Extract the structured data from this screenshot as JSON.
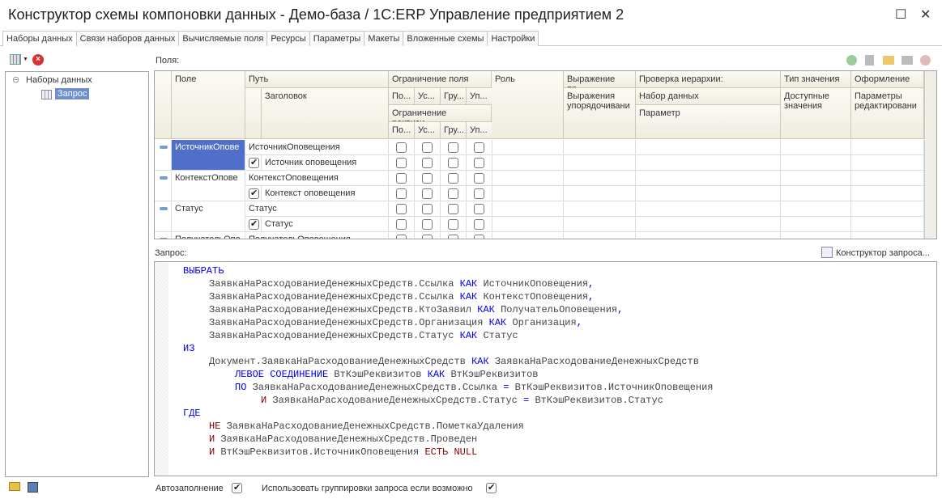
{
  "window": {
    "title": "Конструктор схемы компоновки данных - Демо-база / 1С:ERP Управление предприятием 2",
    "maximize": "☐",
    "close": "✕"
  },
  "tabs": [
    "Наборы данных",
    "Связи наборов данных",
    "Вычисляемые поля",
    "Ресурсы",
    "Параметры",
    "Макеты",
    "Вложенные схемы",
    "Настройки"
  ],
  "tree": {
    "root": "Наборы данных",
    "child": "Запрос"
  },
  "fields": {
    "label": "Поля:",
    "headers": {
      "field": "Поле",
      "path": "Путь",
      "title": "Заголовок",
      "restrict": "Ограничение поля",
      "r1": "По...",
      "r2": "Ус...",
      "r3": "Гру...",
      "r4": "Уп...",
      "restrictAttr": "Ограничение реквизи...",
      "role": "Роль",
      "expr": "Выражение пр...",
      "exprOrder": "Выражения упорядочивани",
      "hier": "Проверка иерархии:",
      "hierSet": "Набор данных",
      "hierParam": "Параметр",
      "type": "Тип значения",
      "avail": "Доступные значения",
      "design": "Оформление",
      "editParams": "Параметры редактировани"
    },
    "rows": [
      {
        "field": "ИсточникОпове",
        "path": "ИсточникОповещения",
        "title": "Источник оповещения",
        "titleChecked": true,
        "selected": true
      },
      {
        "field": "КонтекстОпове",
        "path": "КонтекстОповещения",
        "title": "Контекст оповещения",
        "titleChecked": true,
        "selected": false
      },
      {
        "field": "Статус",
        "path": "Статус",
        "title": "Статус",
        "titleChecked": true,
        "selected": false
      },
      {
        "field": "ПолучательОпо",
        "path": "ПолучательОповещения",
        "title": "",
        "titleChecked": false,
        "selected": false
      }
    ]
  },
  "query": {
    "label": "Запрос:",
    "constructor": "Конструктор запроса...",
    "lines": [
      {
        "indent": 0,
        "tokens": [
          [
            "kw",
            "ВЫБРАТЬ"
          ]
        ]
      },
      {
        "indent": 1,
        "tokens": [
          [
            "t",
            "ЗаявкаНаРасходованиеДенежныхСредств.Ссылка "
          ],
          [
            "kw",
            "КАК"
          ],
          [
            "t",
            " ИсточникОповещения"
          ],
          [
            "kw",
            ","
          ]
        ]
      },
      {
        "indent": 1,
        "tokens": [
          [
            "t",
            "ЗаявкаНаРасходованиеДенежныхСредств.Ссылка "
          ],
          [
            "kw",
            "КАК"
          ],
          [
            "t",
            " КонтекстОповещения"
          ],
          [
            "kw",
            ","
          ]
        ]
      },
      {
        "indent": 1,
        "tokens": [
          [
            "t",
            "ЗаявкаНаРасходованиеДенежныхСредств.КтоЗаявил "
          ],
          [
            "kw",
            "КАК"
          ],
          [
            "t",
            " ПолучательОповещения"
          ],
          [
            "kw",
            ","
          ]
        ]
      },
      {
        "indent": 1,
        "tokens": [
          [
            "t",
            "ЗаявкаНаРасходованиеДенежныхСредств.Организация "
          ],
          [
            "kw",
            "КАК"
          ],
          [
            "t",
            " Организация"
          ],
          [
            "kw",
            ","
          ]
        ]
      },
      {
        "indent": 1,
        "tokens": [
          [
            "t",
            "ЗаявкаНаРасходованиеДенежныхСредств.Статус "
          ],
          [
            "kw",
            "КАК"
          ],
          [
            "t",
            " Статус"
          ]
        ]
      },
      {
        "indent": 0,
        "tokens": [
          [
            "kw",
            "ИЗ"
          ]
        ]
      },
      {
        "indent": 1,
        "tokens": [
          [
            "t",
            "Документ.ЗаявкаНаРасходованиеДенежныхСредств "
          ],
          [
            "kw",
            "КАК"
          ],
          [
            "t",
            " ЗаявкаНаРасходованиеДенежныхСредств"
          ]
        ]
      },
      {
        "indent": 2,
        "tokens": [
          [
            "kw",
            "ЛЕВОЕ СОЕДИНЕНИЕ"
          ],
          [
            "t",
            " ВтКэшРеквизитов "
          ],
          [
            "kw",
            "КАК"
          ],
          [
            "t",
            " ВтКэшРеквизитов"
          ]
        ]
      },
      {
        "indent": 2,
        "tokens": [
          [
            "kw",
            "ПО"
          ],
          [
            "t",
            " ЗаявкаНаРасходованиеДенежныхСредств.Ссылка "
          ],
          [
            "kw",
            "="
          ],
          [
            "t",
            " ВтКэшРеквизитов.ИсточникОповещения"
          ]
        ]
      },
      {
        "indent": 3,
        "tokens": [
          [
            "op",
            "И"
          ],
          [
            "t",
            " ЗаявкаНаРасходованиеДенежныхСредств.Статус "
          ],
          [
            "kw",
            "="
          ],
          [
            "t",
            " ВтКэшРеквизитов.Статус"
          ]
        ]
      },
      {
        "indent": 0,
        "tokens": [
          [
            "kw",
            "ГДЕ"
          ]
        ]
      },
      {
        "indent": 1,
        "tokens": [
          [
            "op",
            "НЕ"
          ],
          [
            "t",
            " ЗаявкаНаРасходованиеДенежныхСредств.ПометкаУдаления"
          ]
        ]
      },
      {
        "indent": 1,
        "tokens": [
          [
            "op",
            "И"
          ],
          [
            "t",
            " ЗаявкаНаРасходованиеДенежныхСредств.Проведен"
          ]
        ]
      },
      {
        "indent": 1,
        "tokens": [
          [
            "op",
            "И"
          ],
          [
            "t",
            " ВтКэшРеквизитов.ИсточникОповещения "
          ],
          [
            "op",
            "ЕСТЬ NULL"
          ]
        ]
      }
    ]
  },
  "footer": {
    "autofill": "Автозаполнение",
    "autofillChecked": true,
    "useGroups": "Использовать группировки запроса если возможно",
    "useGroupsChecked": true
  },
  "colors": {
    "keyword": "#0000ee",
    "operator": "#8b0000",
    "selection": "#4f6fc8"
  }
}
